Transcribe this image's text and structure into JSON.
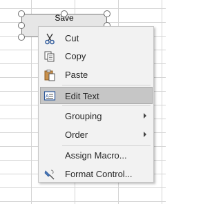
{
  "form_control": {
    "label": "Save"
  },
  "context_menu": {
    "items": [
      {
        "label": "Cut",
        "icon": "scissors-icon"
      },
      {
        "label": "Copy",
        "icon": "copy-icon"
      },
      {
        "label": "Paste",
        "icon": "paste-icon"
      },
      {
        "label": "Edit Text",
        "icon": "edit-text-icon",
        "highlighted": true
      },
      {
        "label": "Grouping",
        "submenu": true
      },
      {
        "label": "Order",
        "submenu": true
      },
      {
        "label": "Assign Macro..."
      },
      {
        "label": "Format Control...",
        "icon": "format-control-icon"
      }
    ]
  },
  "colors": {
    "menu_bg": "#f2f2f2",
    "highlight": "#c6c6c6",
    "gridline": "#d4d4d4"
  }
}
